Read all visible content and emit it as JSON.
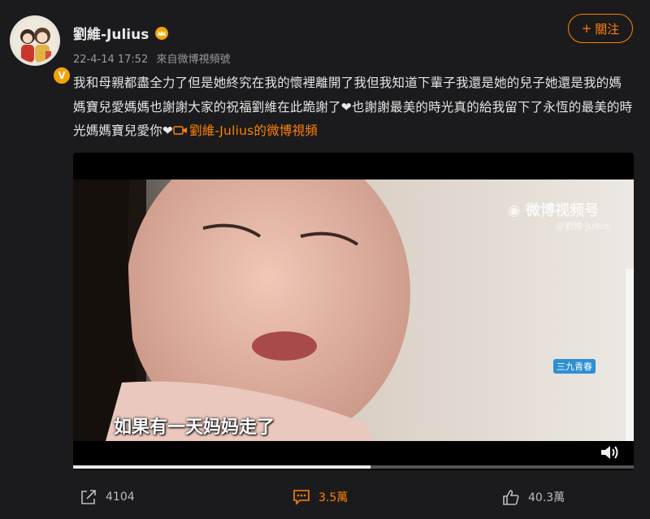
{
  "post": {
    "username": "劉維-Julius",
    "date": "22-4-14 17:52",
    "source": "來自微博視頻號",
    "follow_label": "關注",
    "text_main": "我和母親都盡全力了但是她終究在我的懷裡離開了我但我知道下輩子我還是她的兒子她還是我的媽媽寶兒愛媽媽也謝謝大家的祝福劉維在此跪謝了",
    "text_mid": "也謝謝最美的時光真的給我留下了永恆的最美的時光媽媽寶兒愛你",
    "link_text": "劉維-Julius的微博視頻"
  },
  "video": {
    "subtitle": "如果有一天妈妈走了",
    "watermark": "微博视频号",
    "watermark_sub": "@劉維-Julius",
    "show_label": "三九青春",
    "progress_fraction": 0.53
  },
  "actions": {
    "share_count": "4104",
    "comment_count": "3.5萬",
    "like_count": "40.3萬"
  },
  "colors": {
    "accent": "#ff8200",
    "background": "#1b1b1e",
    "verified": "#f2a20a"
  },
  "icons": [
    "verified-badge-icon",
    "crown-icon",
    "plus-icon",
    "heart-icon",
    "video-camera-icon",
    "speaker-icon",
    "share-icon",
    "comment-icon",
    "like-icon"
  ]
}
